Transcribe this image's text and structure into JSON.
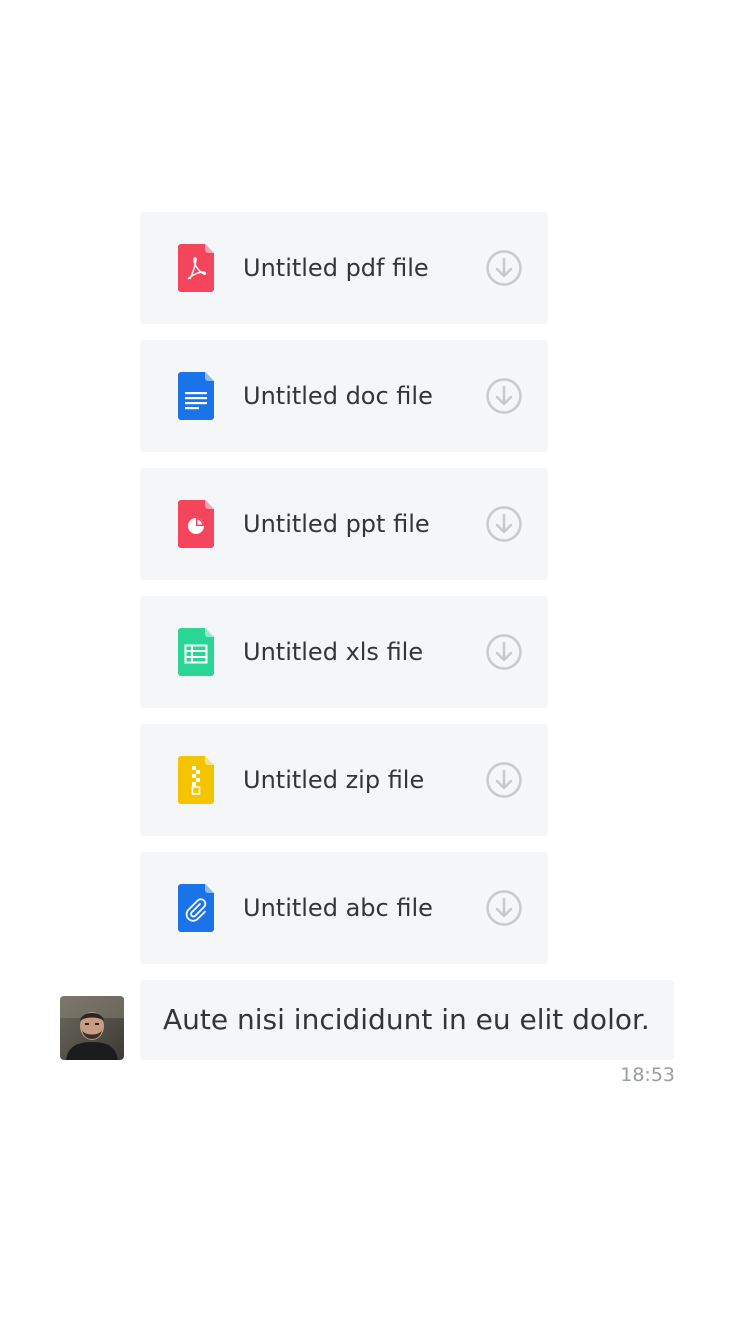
{
  "files": [
    {
      "name": "Untitled pdf file",
      "type": "pdf",
      "icon": "pdf-file-icon",
      "color": "#f5455c"
    },
    {
      "name": "Untitled doc file",
      "type": "doc",
      "icon": "doc-file-icon",
      "color": "#1a73e8"
    },
    {
      "name": "Untitled ppt file",
      "type": "ppt",
      "icon": "ppt-file-icon",
      "color": "#f5455c"
    },
    {
      "name": "Untitled xls file",
      "type": "xls",
      "icon": "xls-file-icon",
      "color": "#2bd596"
    },
    {
      "name": "Untitled zip file",
      "type": "zip",
      "icon": "zip-file-icon",
      "color": "#f5c400"
    },
    {
      "name": "Untitled abc file",
      "type": "abc",
      "icon": "attachment-file-icon",
      "color": "#1a73e8"
    }
  ],
  "message": {
    "text": "Aute nisi incididunt in eu elit dolor.",
    "time": "18:53",
    "avatar_icon": "user-avatar"
  },
  "colors": {
    "card_background": "#f5f6f8",
    "text": "#33353b",
    "download_icon": "#c8c9cc",
    "timestamp": "#9a9ca3"
  }
}
